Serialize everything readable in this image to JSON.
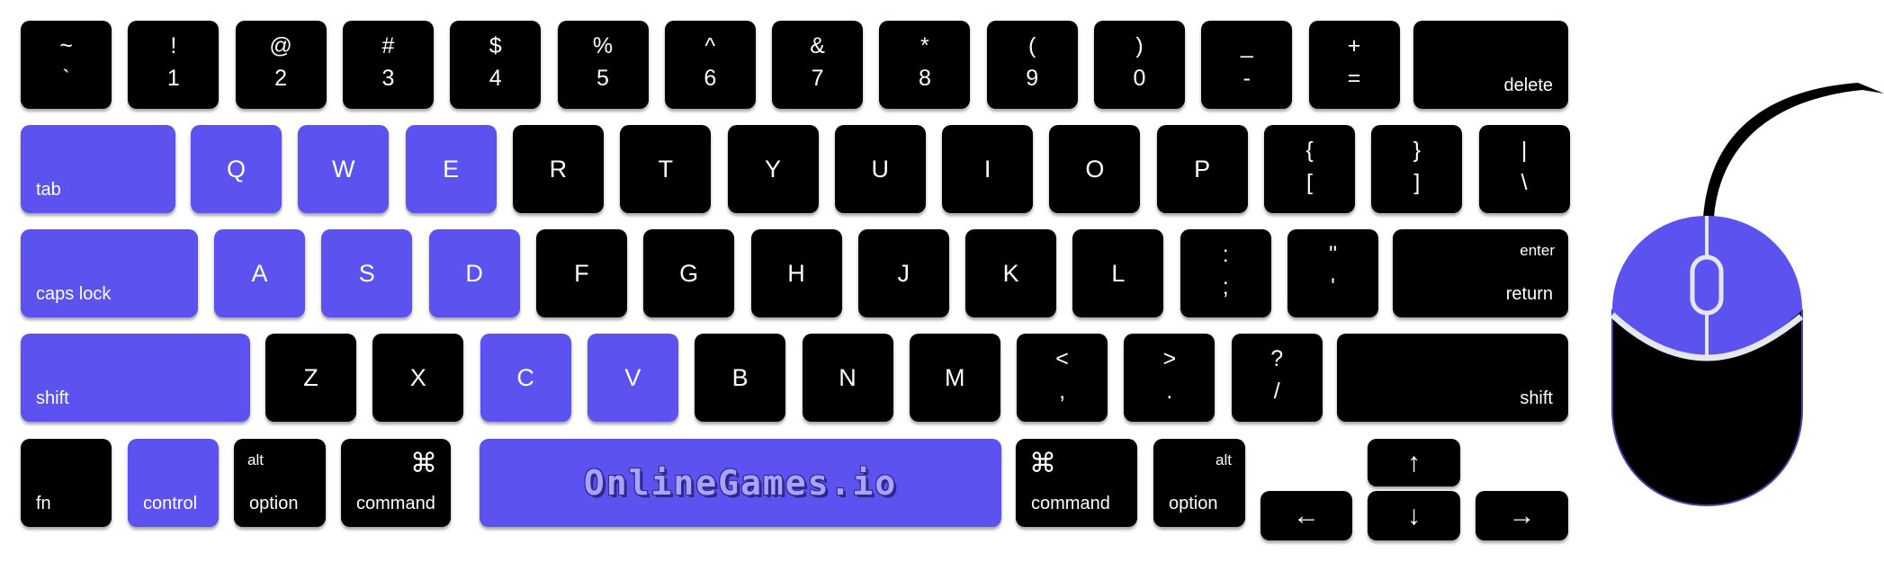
{
  "colors": {
    "key": "#000000",
    "highlight": "#5b52ef",
    "label": "#ffffff",
    "mouse_line": "#e6e6ee"
  },
  "highlighted_keys": [
    "tab",
    "Q",
    "W",
    "E",
    "caps lock",
    "A",
    "S",
    "D",
    "shift",
    "C",
    "V",
    "control",
    "space"
  ],
  "rows": [
    [
      {
        "top": "~",
        "bottom": "`"
      },
      {
        "top": "!",
        "bottom": "1"
      },
      {
        "top": "@",
        "bottom": "2"
      },
      {
        "top": "#",
        "bottom": "3"
      },
      {
        "top": "$",
        "bottom": "4"
      },
      {
        "top": "%",
        "bottom": "5"
      },
      {
        "top": "^",
        "bottom": "6"
      },
      {
        "top": "&",
        "bottom": "7"
      },
      {
        "top": "*",
        "bottom": "8"
      },
      {
        "top": "(",
        "bottom": "9"
      },
      {
        "top": ")",
        "bottom": "0"
      },
      {
        "top": "_",
        "bottom": "-"
      },
      {
        "top": "+",
        "bottom": "="
      },
      {
        "label": "delete"
      }
    ],
    [
      {
        "label": "tab",
        "highlighted": true
      },
      {
        "label": "Q",
        "highlighted": true
      },
      {
        "label": "W",
        "highlighted": true
      },
      {
        "label": "E",
        "highlighted": true
      },
      {
        "label": "R"
      },
      {
        "label": "T"
      },
      {
        "label": "Y"
      },
      {
        "label": "U"
      },
      {
        "label": "I"
      },
      {
        "label": "O"
      },
      {
        "label": "P"
      },
      {
        "top": "{",
        "bottom": "["
      },
      {
        "top": "}",
        "bottom": "]"
      },
      {
        "top": "|",
        "bottom": "\\"
      }
    ],
    [
      {
        "label": "caps lock",
        "highlighted": true
      },
      {
        "label": "A",
        "highlighted": true
      },
      {
        "label": "S",
        "highlighted": true
      },
      {
        "label": "D",
        "highlighted": true
      },
      {
        "label": "F"
      },
      {
        "label": "G"
      },
      {
        "label": "H"
      },
      {
        "label": "J"
      },
      {
        "label": "K"
      },
      {
        "label": "L"
      },
      {
        "top": ":",
        "bottom": ";"
      },
      {
        "top": "\"",
        "bottom": "'"
      },
      {
        "label": "return",
        "corner": "enter"
      }
    ],
    [
      {
        "label": "shift",
        "highlighted": true
      },
      {
        "label": "Z"
      },
      {
        "label": "X"
      },
      {
        "label": "C",
        "highlighted": true
      },
      {
        "label": "V",
        "highlighted": true
      },
      {
        "label": "B"
      },
      {
        "label": "N"
      },
      {
        "label": "M"
      },
      {
        "top": "<",
        "bottom": ","
      },
      {
        "top": ">",
        "bottom": "."
      },
      {
        "top": "?",
        "bottom": "/"
      },
      {
        "label": "shift"
      }
    ],
    [
      {
        "label": "fn"
      },
      {
        "label": "control",
        "highlighted": true
      },
      {
        "label": "option",
        "corner": "alt"
      },
      {
        "label": "command",
        "corner": "⌘"
      },
      {
        "label": "",
        "logo": "OnlineGames.io",
        "highlighted": true
      },
      {
        "label": "command",
        "corner": "⌘"
      },
      {
        "label": "option",
        "corner": "alt"
      },
      {
        "label": "←"
      },
      {
        "label": "↑"
      },
      {
        "label": "↓"
      },
      {
        "label": "→"
      }
    ]
  ],
  "mouse": {
    "highlighted_part": "top buttons"
  }
}
